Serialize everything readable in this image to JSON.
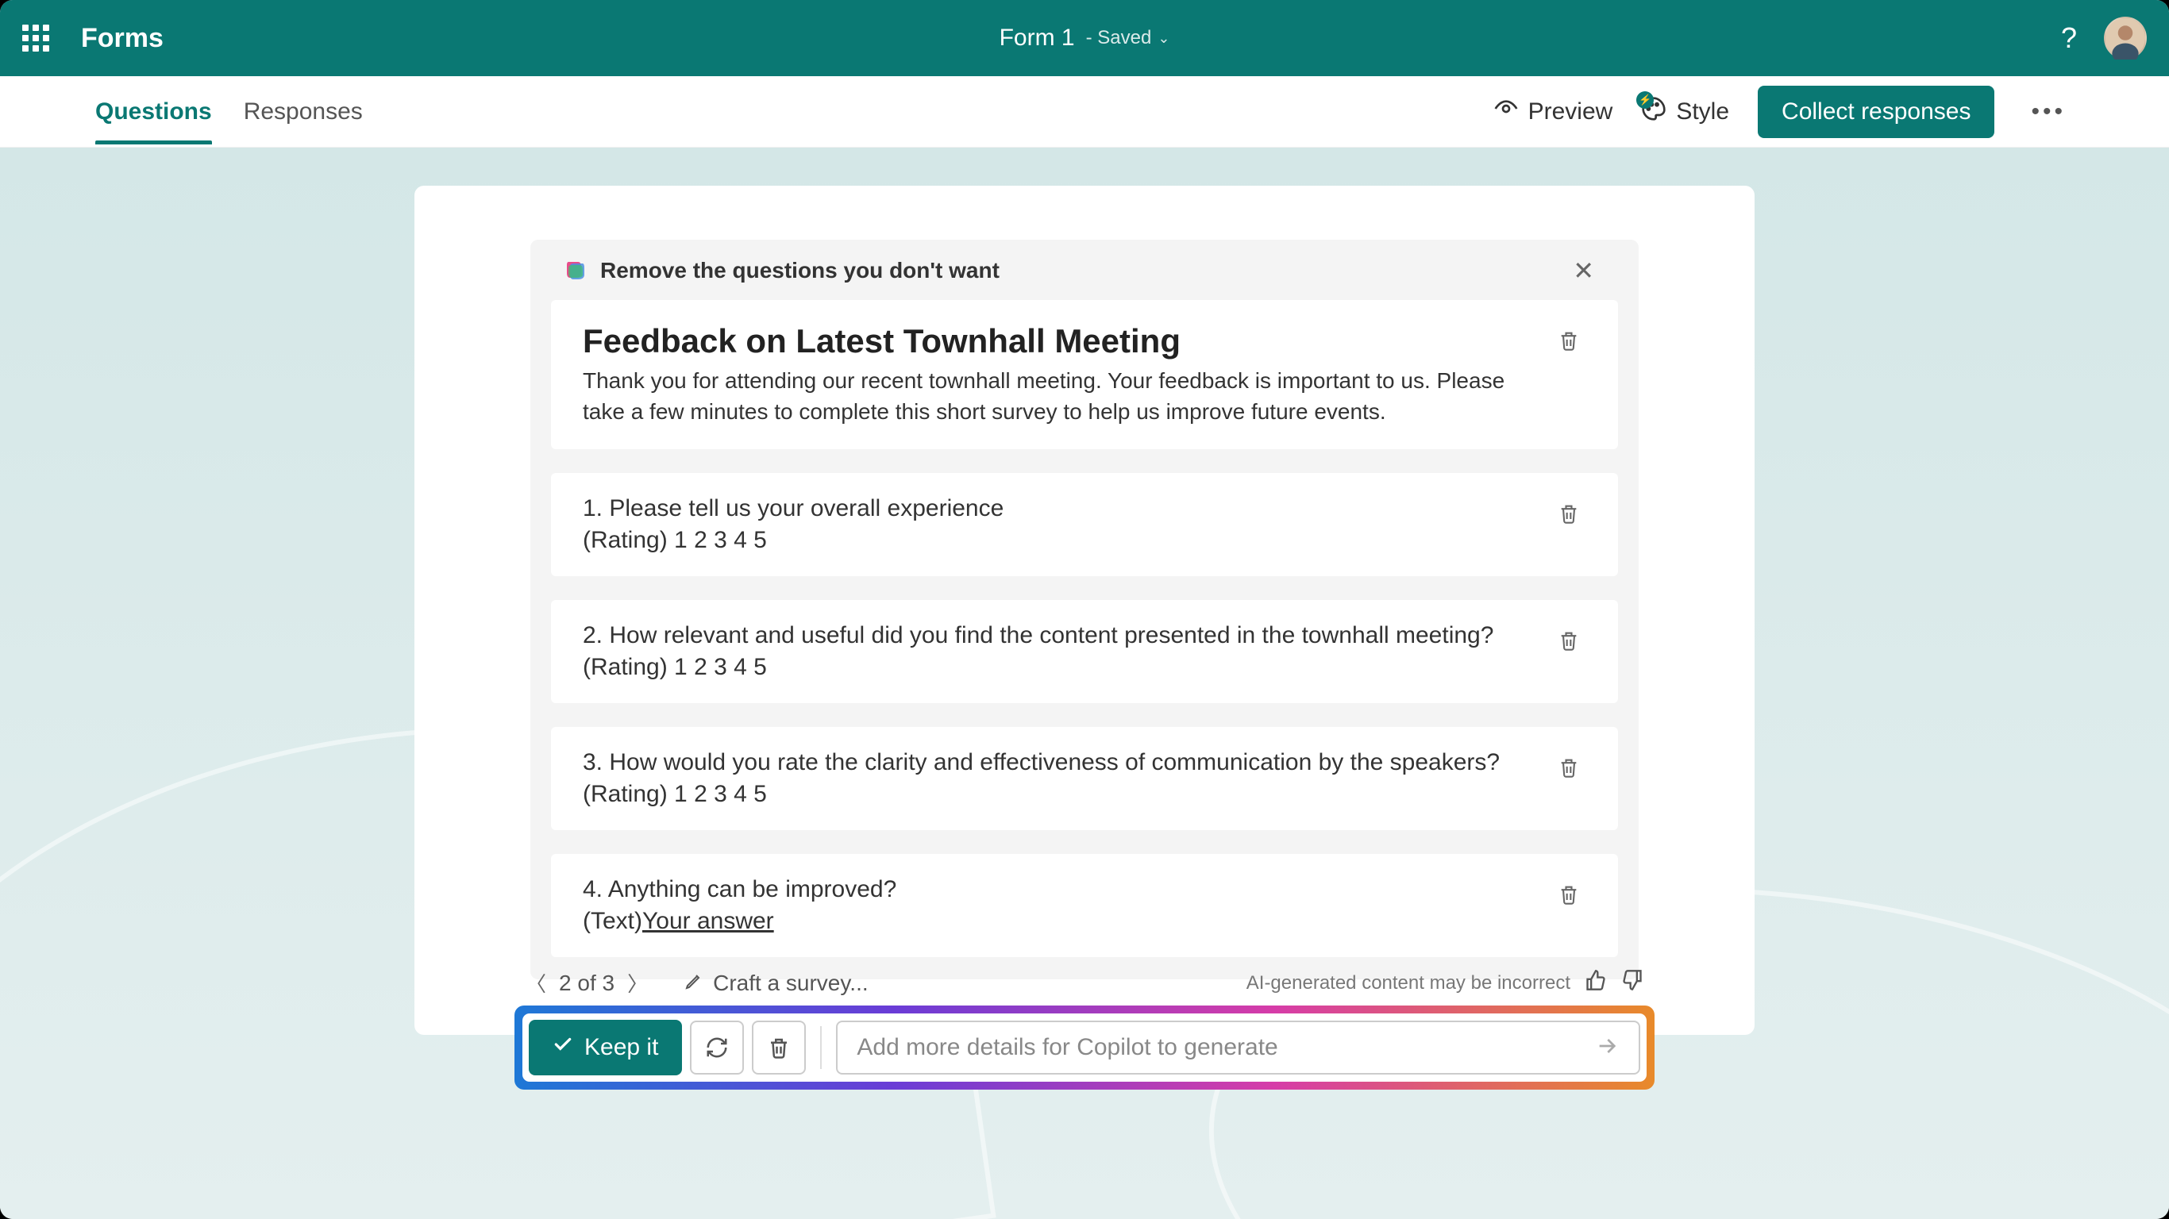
{
  "header": {
    "app_name": "Forms",
    "form_title": "Form 1",
    "saved_label": "- Saved"
  },
  "tabs": {
    "questions": "Questions",
    "responses": "Responses"
  },
  "actions": {
    "preview": "Preview",
    "style": "Style",
    "collect": "Collect responses"
  },
  "copilot": {
    "instruction": "Remove the questions you don't want",
    "form_title": "Feedback on Latest Townhall Meeting",
    "form_desc": "Thank you for attending our recent townhall meeting. Your feedback is important to us. Please take a few minutes to complete this short survey to help us improve future events."
  },
  "questions": {
    "q1": {
      "text": "1. Please tell us your overall experience",
      "type": "(Rating)",
      "nums": "1   2   3   4   5"
    },
    "q2": {
      "text": "2. How relevant and useful did you find the content presented in the townhall meeting?",
      "type": "(Rating)",
      "nums": "1   2   3   4   5"
    },
    "q3": {
      "text": "3. How would you rate the clarity and effectiveness of communication by the speakers?",
      "type": "(Rating)",
      "nums": "1   2   3   4   5"
    },
    "q4": {
      "text": "4. Anything can be improved?",
      "type": "(Text)",
      "placeholder": "Your answer"
    }
  },
  "pager": {
    "position": "2 of 3",
    "craft": "Craft a survey...",
    "ai_note": "AI-generated content may be incorrect"
  },
  "bottom": {
    "keep": "Keep it",
    "input_placeholder": "Add more details for Copilot to generate"
  }
}
